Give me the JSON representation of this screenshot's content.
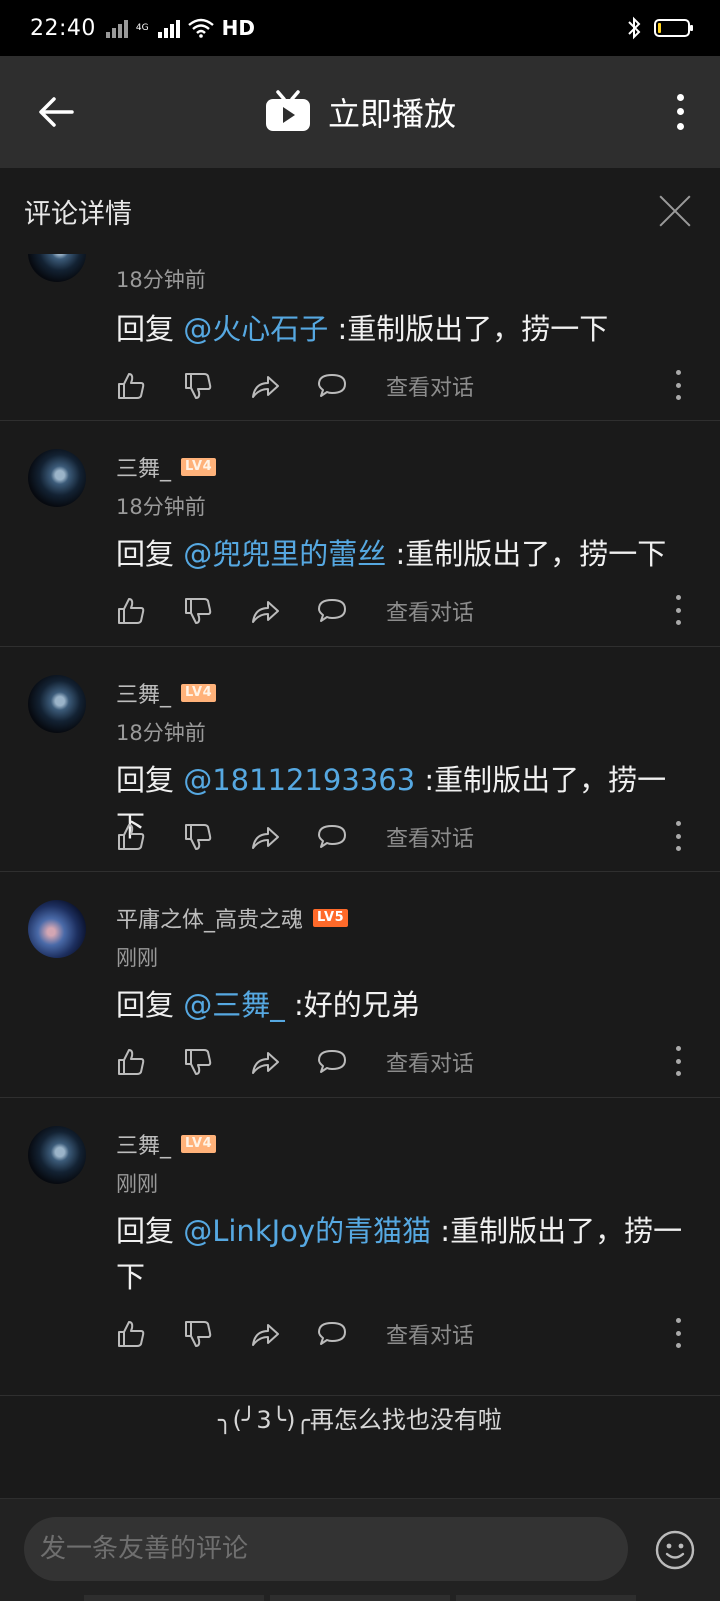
{
  "status_bar": {
    "time": "22:40",
    "network": "4G",
    "hd": "HD",
    "battery_level": 0.1
  },
  "app_bar": {
    "title": "立即播放",
    "icons": {
      "back": "arrow-left-icon",
      "logo": "tv-icon",
      "more": "more-vertical-icon"
    }
  },
  "panel": {
    "title": "评论详情",
    "close_icon": "close-icon"
  },
  "actions": {
    "like_icon": "thumbs-up-icon",
    "dislike_icon": "thumbs-down-icon",
    "share_icon": "share-icon",
    "reply_icon": "comment-bubble-icon",
    "view_convo": "查看对话",
    "more_icon": "more-vertical-icon"
  },
  "comments": [
    {
      "username": "",
      "level": "",
      "time": "18分钟前",
      "reply_prefix": "回复 ",
      "mention": "@火心石子",
      "text": " :重制版出了，捞一下"
    },
    {
      "username": "三舞_",
      "level": "LV4",
      "time": "18分钟前",
      "reply_prefix": "回复 ",
      "mention": "@兜兜里的蕾丝",
      "text": " :重制版出了，捞一下"
    },
    {
      "username": "三舞_",
      "level": "LV4",
      "time": "18分钟前",
      "reply_prefix": "回复 ",
      "mention": "@18112193363",
      "text": " :重制版出了，捞一下"
    },
    {
      "username": "平庸之体_高贵之魂",
      "level": "LV5",
      "time": "刚刚",
      "reply_prefix": "回复 ",
      "mention": "@三舞_",
      "text": " :好的兄弟"
    },
    {
      "username": "三舞_",
      "level": "LV4",
      "time": "刚刚",
      "reply_prefix": "回复 ",
      "mention": "@LinkJoy的青猫猫",
      "text": " :重制版出了，捞一下"
    }
  ],
  "end_note": "╮(╯3╰)╭再怎么找也没有啦",
  "input": {
    "placeholder": "发一条友善的评论",
    "emoji_icon": "emoji-smile-icon"
  }
}
